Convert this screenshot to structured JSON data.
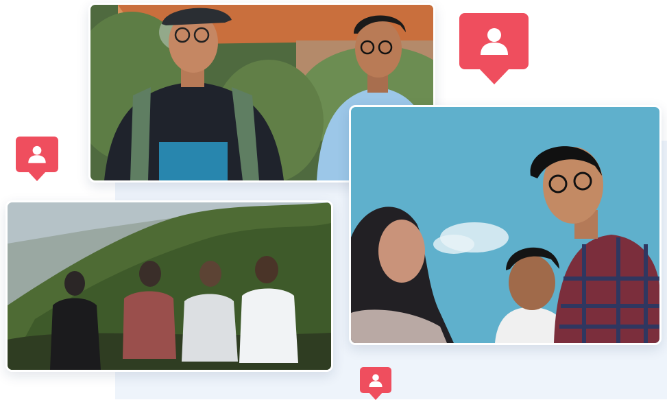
{
  "scene": {
    "accent_color": "#ef4e5e",
    "backdrop_color": "#eef4fb",
    "photos": [
      {
        "name": "two-friends-laughing-photo"
      },
      {
        "name": "friends-sitting-on-hill-photo"
      },
      {
        "name": "friends-smiling-sky-photo"
      }
    ],
    "markers": [
      {
        "icon": "user-icon"
      },
      {
        "icon": "user-icon"
      },
      {
        "icon": "user-icon"
      }
    ]
  }
}
